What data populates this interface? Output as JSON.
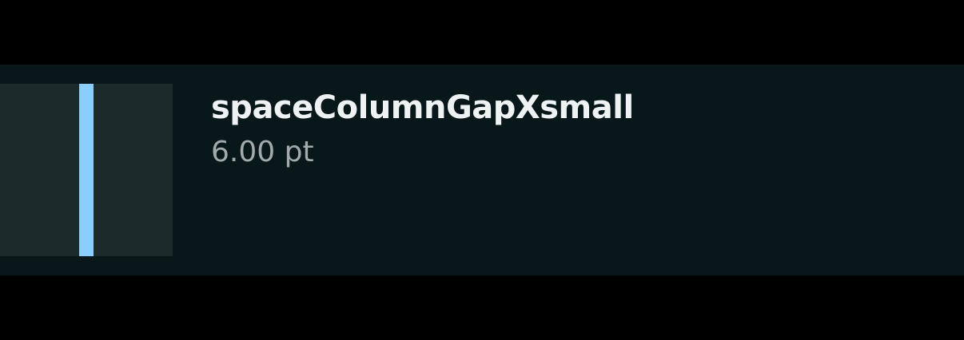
{
  "token": {
    "name": "spaceColumnGapXsmall",
    "value": "6.00 pt"
  },
  "colors": {
    "background": "#000000",
    "row_background": "#08171a",
    "swatch_background": "#1c2a2b",
    "gap_indicator": "#8ccdff",
    "name_text": "#eef2f3",
    "value_text": "#a3aaac"
  }
}
